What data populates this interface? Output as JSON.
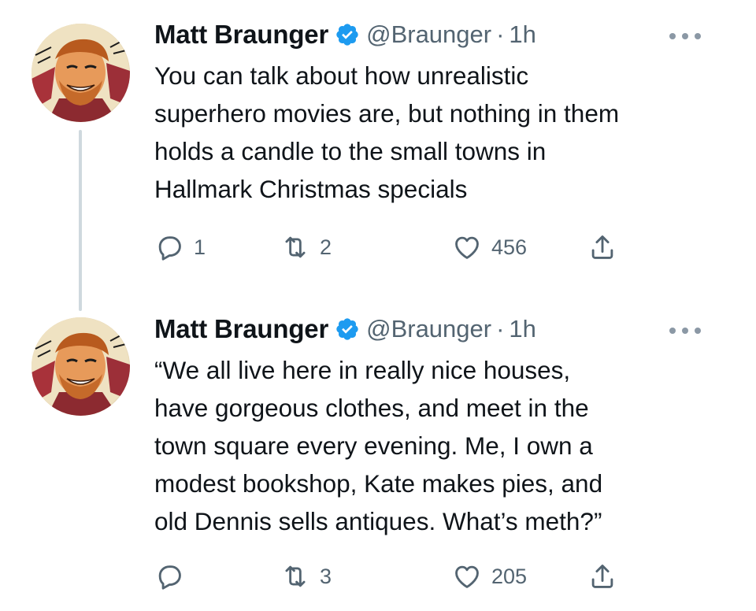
{
  "tweets": [
    {
      "author": {
        "name": "Matt Braunger",
        "handle": "@Braunger",
        "time": "1h",
        "verified": true,
        "avatar_icon": "cartoon-avatar-icon"
      },
      "text_lines": [
        "You can talk about how unrealistic",
        "superhero movies are, but nothing in them",
        "holds a candle to the small towns in",
        "Hallmark Christmas specials"
      ],
      "actions": {
        "replies": "1",
        "retweets": "2",
        "likes": "456"
      }
    },
    {
      "author": {
        "name": "Matt Braunger",
        "handle": "@Braunger",
        "time": "1h",
        "verified": true,
        "avatar_icon": "cartoon-avatar-icon"
      },
      "text_lines": [
        "“We all live here in really nice houses,",
        "have gorgeous clothes, and meet in the",
        "town square every evening. Me, I own a",
        "modest bookshop, Kate makes pies, and",
        "old Dennis sells antiques. What’s meth?”"
      ],
      "actions": {
        "replies": "",
        "retweets": "3",
        "likes": "205"
      }
    }
  ],
  "separator": "·",
  "colors": {
    "verified": "#1d9bf0",
    "secondary_text": "#536471",
    "thread_line": "#cfd9de"
  }
}
